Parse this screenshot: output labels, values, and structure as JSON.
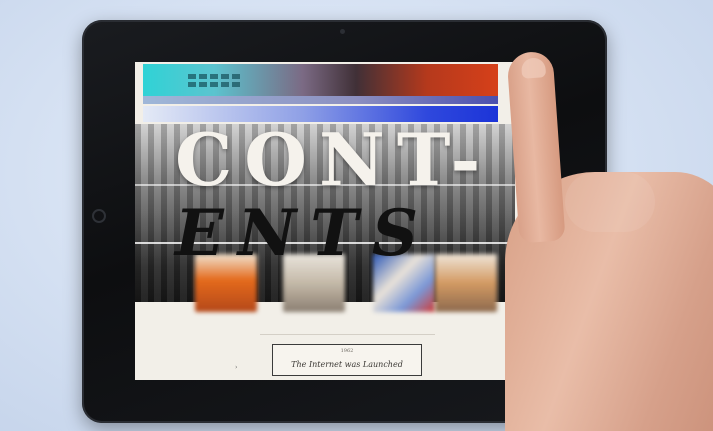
{
  "screen": {
    "headline_line_1": "CONT-",
    "headline_line_2": "ENTS",
    "event": {
      "year": "1962",
      "title": "The Internet was Launched"
    }
  }
}
